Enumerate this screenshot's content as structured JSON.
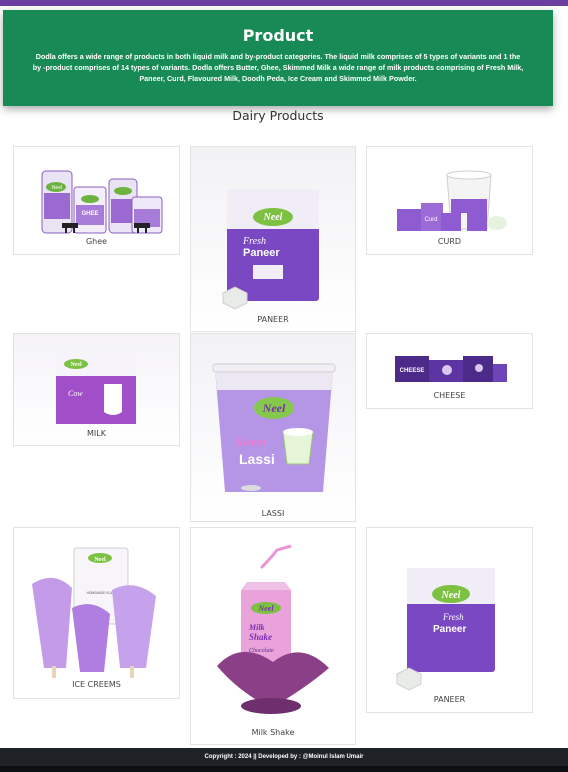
{
  "hero": {
    "title": "Product",
    "description": "Dodla offers a wide range of products in both liquid milk and by-product categories. The liquid milk comprises of 5 types of variants and 1 the by -product comprises of 14 types of variants. Dodla offers Butter, Ghee, Skimmed Milk a wide range of milk products comprising of Fresh Milk, Paneer, Curd, Flavoured Milk, Doodh Peda, Ice Cream and Skimmed Milk Powder."
  },
  "section": {
    "title": "Dairy Products"
  },
  "products": [
    {
      "label": "Ghee",
      "image": "ghee-packs-image"
    },
    {
      "label": "PANEER",
      "image": "paneer-pack-image"
    },
    {
      "label": "CURD",
      "image": "curd-pack-image"
    },
    {
      "label": "MILK",
      "image": "milk-pouch-image"
    },
    {
      "label": "LASSI",
      "image": "sweet-lassi-cup-image"
    },
    {
      "label": "CHEESE",
      "image": "cheese-box-image"
    },
    {
      "label": "ICE CREEMS",
      "image": "kulfi-ice-cream-image"
    },
    {
      "label": "Milk Shake",
      "image": "chocolate-milk-shake-image"
    },
    {
      "label": "PANEER",
      "image": "paneer-pack-image"
    }
  ],
  "brand": {
    "logo_text": "Neel"
  },
  "package_text": {
    "ghee": "GHEE",
    "paneer_fresh": "Fresh",
    "paneer": "Paneer",
    "curd": "Curd",
    "milk_word": "Cow",
    "cheese": "CHEESE",
    "lassi_sweet": "Sweet",
    "lassi": "Lassi",
    "kulfi": "HOMEMADE KULFI",
    "shake_milk": "Milk",
    "shake": "Shake",
    "shake_flavour": "Chocolate"
  },
  "footer": {
    "text": "Copyright : 2024 || Developed by : @Moinul Islam Umair"
  },
  "colors": {
    "purple": "#6b3fa0",
    "green": "#178a55",
    "footer": "#1f2328"
  }
}
